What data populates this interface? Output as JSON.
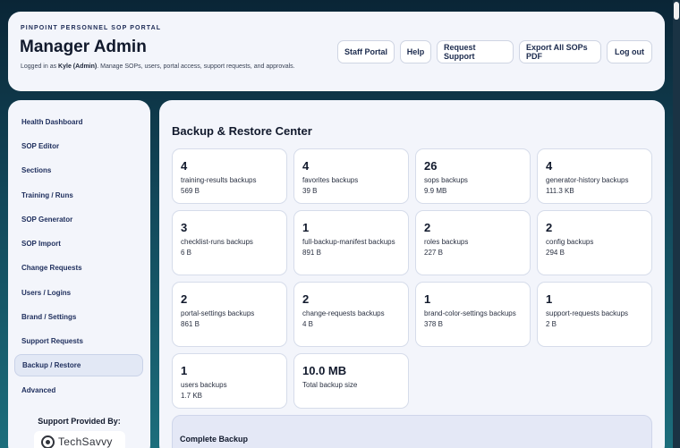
{
  "header": {
    "portal_name": "PINPOINT PERSONNEL SOP PORTAL",
    "title": "Manager Admin",
    "subtitle_prefix": "Logged in as ",
    "user": "Kyle (Admin)",
    "subtitle_suffix": ". Manage SOPs, users, portal access, support requests, and approvals.",
    "buttons": [
      "Staff Portal",
      "Help",
      "Request Support",
      "Export All SOPs PDF",
      "Log out"
    ]
  },
  "sidebar": {
    "items": [
      {
        "label": "Health Dashboard"
      },
      {
        "label": "SOP Editor"
      },
      {
        "label": "Sections"
      },
      {
        "label": "Training / Runs"
      },
      {
        "label": "SOP Generator"
      },
      {
        "label": "SOP Import"
      },
      {
        "label": "Change Requests"
      },
      {
        "label": "Users / Logins"
      },
      {
        "label": "Brand / Settings"
      },
      {
        "label": "Support Requests"
      },
      {
        "label": "Backup / Restore"
      },
      {
        "label": "Advanced"
      }
    ],
    "active": "Backup / Restore",
    "support_title": "Support Provided By:",
    "support_logo_text": "TechSavvy"
  },
  "main": {
    "title": "Backup & Restore Center",
    "cards": [
      {
        "value": "4",
        "label": "training-results backups",
        "size": "569 B"
      },
      {
        "value": "4",
        "label": "favorites backups",
        "size": "39 B"
      },
      {
        "value": "26",
        "label": "sops backups",
        "size": "9.9 MB"
      },
      {
        "value": "4",
        "label": "generator-history backups",
        "size": "111.3 KB"
      },
      {
        "value": "3",
        "label": "checklist-runs backups",
        "size": "6 B"
      },
      {
        "value": "1",
        "label": "full-backup-manifest backups",
        "size": "891 B"
      },
      {
        "value": "2",
        "label": "roles backups",
        "size": "227 B"
      },
      {
        "value": "2",
        "label": "config backups",
        "size": "294 B"
      },
      {
        "value": "2",
        "label": "portal-settings backups",
        "size": "861 B"
      },
      {
        "value": "2",
        "label": "change-requests backups",
        "size": "4 B"
      },
      {
        "value": "1",
        "label": "brand-color-settings backups",
        "size": "378 B"
      },
      {
        "value": "1",
        "label": "support-requests backups",
        "size": "2 B"
      },
      {
        "value": "1",
        "label": "users backups",
        "size": "1.7 KB"
      },
      {
        "value": "10.0 MB",
        "label": "Total backup size",
        "size": ""
      }
    ],
    "complete_backup_title": "Complete Backup"
  }
}
